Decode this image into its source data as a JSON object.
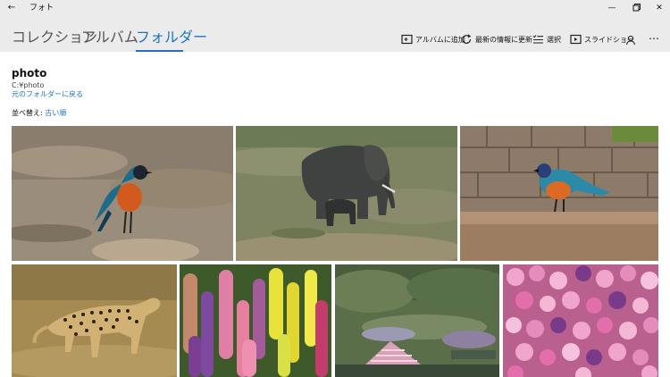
{
  "window": {
    "title": "フォト"
  },
  "tabs": [
    {
      "label": "コレクション"
    },
    {
      "label": "アルバム"
    },
    {
      "label": "フォルダー"
    }
  ],
  "toolbar": {
    "add_album": "アルバムに追加",
    "refresh": "最新の情報に更新",
    "select": "選択",
    "slideshow": "スライドショー"
  },
  "folder": {
    "name": "photo",
    "path": "C:¥photo",
    "back_link": "元のフォルダーに戻る",
    "sort_label": "並べ替え:",
    "sort_value": "古い順"
  },
  "photos": [
    {
      "subject": "bird"
    },
    {
      "subject": "elephants"
    },
    {
      "subject": "bird"
    },
    {
      "subject": "cheetah"
    },
    {
      "subject": "flowers"
    },
    {
      "subject": "garden"
    },
    {
      "subject": "flowers"
    }
  ],
  "colors": {
    "accent": "#1e73c8",
    "chrome": "#ebebeb"
  }
}
